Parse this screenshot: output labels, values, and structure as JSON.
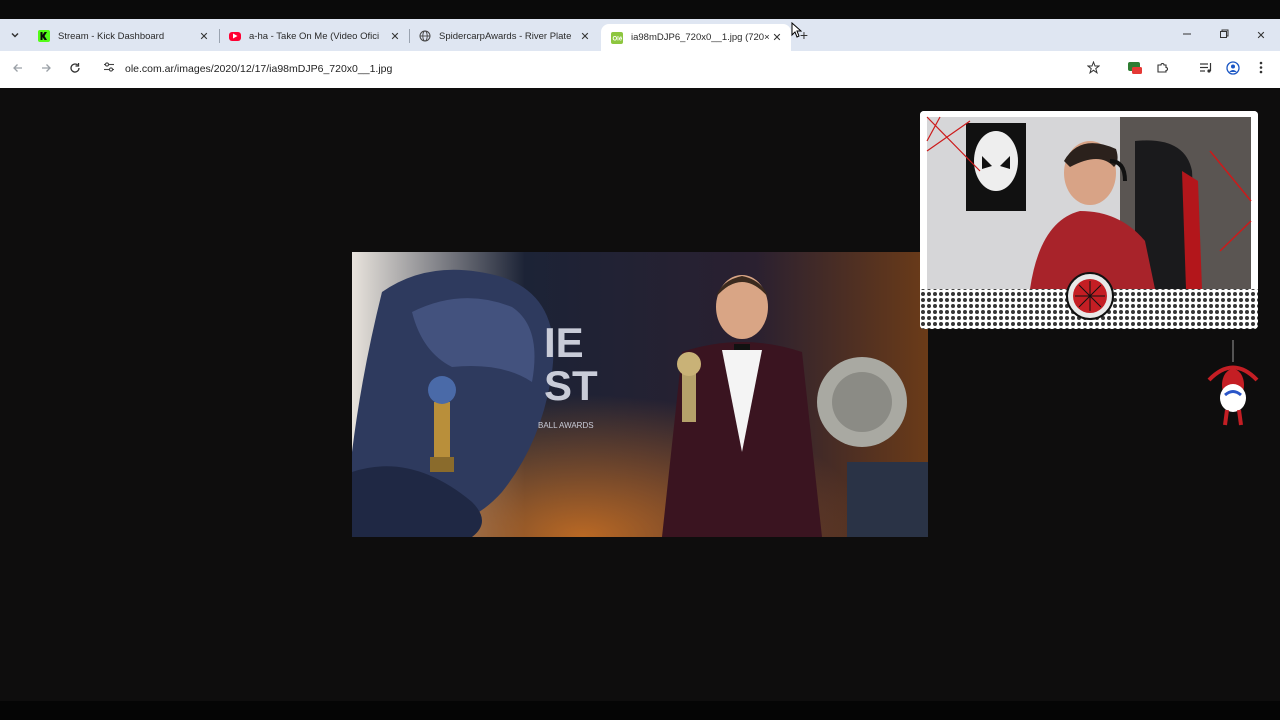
{
  "browser": {
    "tabs": [
      {
        "title": "Stream - Kick Dashboard",
        "favicon": "kick-icon",
        "active": false
      },
      {
        "title": "a-ha - Take On Me (Video Ofici",
        "favicon": "youtube-icon",
        "active": false
      },
      {
        "title": "SpidercarpAwards - River Plate",
        "favicon": "globe-icon",
        "active": false
      },
      {
        "title": "ia98mDJP6_720x0__1.jpg (720×",
        "favicon": "ole-icon",
        "active": true
      }
    ],
    "url": "ole.com.ar/images/2020/12/17/ia98mDJP6_720x0__1.jpg"
  },
  "colors": {
    "tabstrip": "#dfe6f2",
    "page_background": "#0e0d0d",
    "kick_green": "#53fc18",
    "youtube_red": "#ff0033",
    "ole_green": "#8dc63f"
  },
  "overlay": {
    "webcam_badge_icon": "spider-badge-icon",
    "corner_figure_icon": "hanging-spider-icon"
  }
}
